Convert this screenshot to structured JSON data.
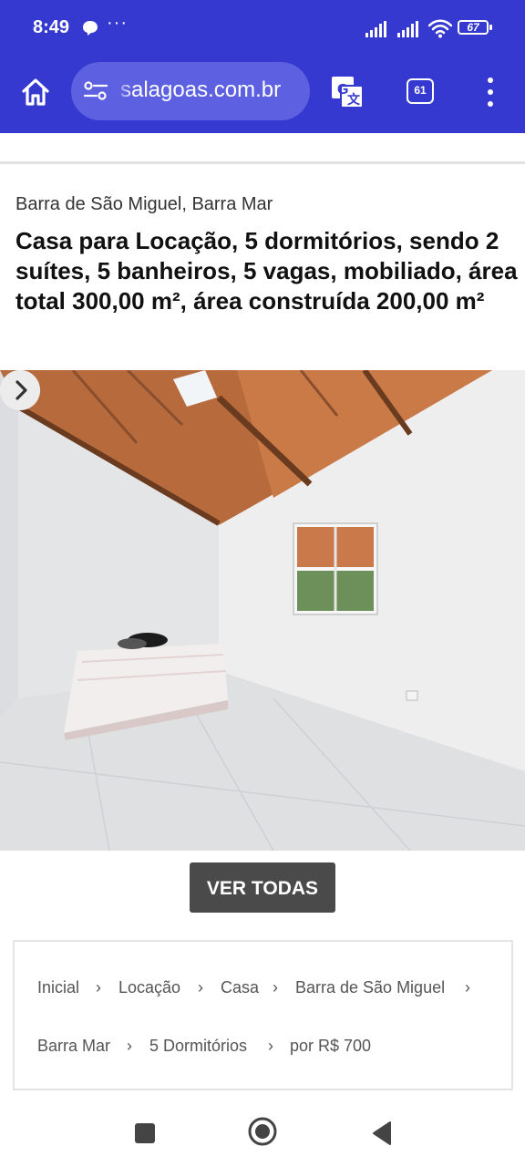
{
  "status_bar": {
    "time": "8:49",
    "more": "···",
    "battery": "67"
  },
  "browser": {
    "url": "salagoas.com.br",
    "tab_count": "61"
  },
  "listing": {
    "location": "Barra de São Miguel, Barra Mar",
    "title": "Casa para Locação, 5 dormitórios, sendo 2 suítes, 5 banheiros, 5 vagas, mobiliado, área total 300,00 m², área construída 200,00 m²"
  },
  "gallery": {
    "view_all_label": "VER TODAS"
  },
  "breadcrumbs": [
    "Inicial",
    "Locação",
    "Casa",
    "Barra de São Miguel",
    "Barra Mar",
    "5 Dormitórios",
    "por R$ 700"
  ],
  "colors": {
    "toolbar": "#3539cf",
    "url_pill": "#5d60e0",
    "button": "#4a4a4a"
  }
}
